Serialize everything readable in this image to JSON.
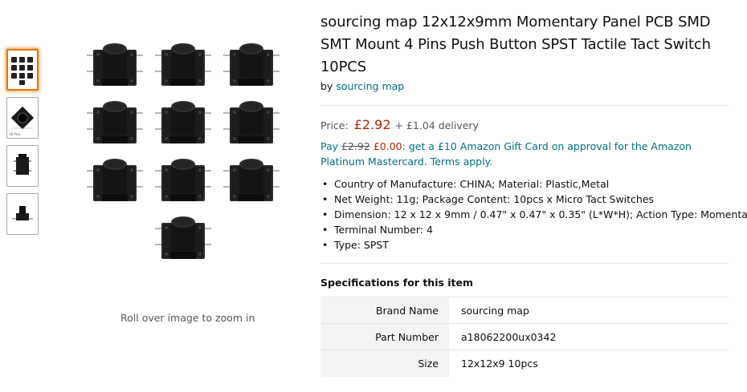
{
  "product": {
    "title": "sourcing map 12x12x9mm Momentary Panel PCB SMD SMT Mount 4 Pins Push Button SPST Tactile Tact Switch 10PCS",
    "by_prefix": "by",
    "brand_link": "sourcing map"
  },
  "thumbnails": [
    {
      "name": "ten-switches-grid",
      "caption": ""
    },
    {
      "name": "switch-dimension-diagram",
      "caption": "t9 Pins"
    },
    {
      "name": "switch-side-view",
      "caption": ""
    },
    {
      "name": "switch-front-view",
      "caption": ""
    }
  ],
  "image": {
    "zoom_hint": "Roll over image to zoom in",
    "switch_count": 10
  },
  "price": {
    "label": "Price:",
    "value": "£2.92",
    "delivery": "+ £1.04 delivery"
  },
  "promo": {
    "pay": "Pay",
    "old_price": "£2.92",
    "new_price": "£0.00",
    "text": "get a £10 Amazon Gift Card on approval for the Amazon Platinum Mastercard. Terms apply."
  },
  "bullets": [
    "Country of Manufacture: CHINA; Material: Plastic,Metal",
    "Net Weight: 11g; Package Content: 10pcs x Micro Tact Switches",
    "Dimension: 12 x 12 x 9mm / 0.47\" x 0.47\" x 0.35\" (L*W*H); Action Type: Momentary",
    "Terminal Number: 4",
    "Type: SPST"
  ],
  "specs": {
    "title": "Specifications for this item",
    "rows": [
      {
        "key": "Brand Name",
        "value": "sourcing map"
      },
      {
        "key": "Part Number",
        "value": "a18062200ux0342"
      },
      {
        "key": "Size",
        "value": "12x12x9 10pcs"
      }
    ]
  },
  "colors": {
    "price": "#b12704",
    "link": "#007185",
    "thumb_active": "#e77600"
  }
}
